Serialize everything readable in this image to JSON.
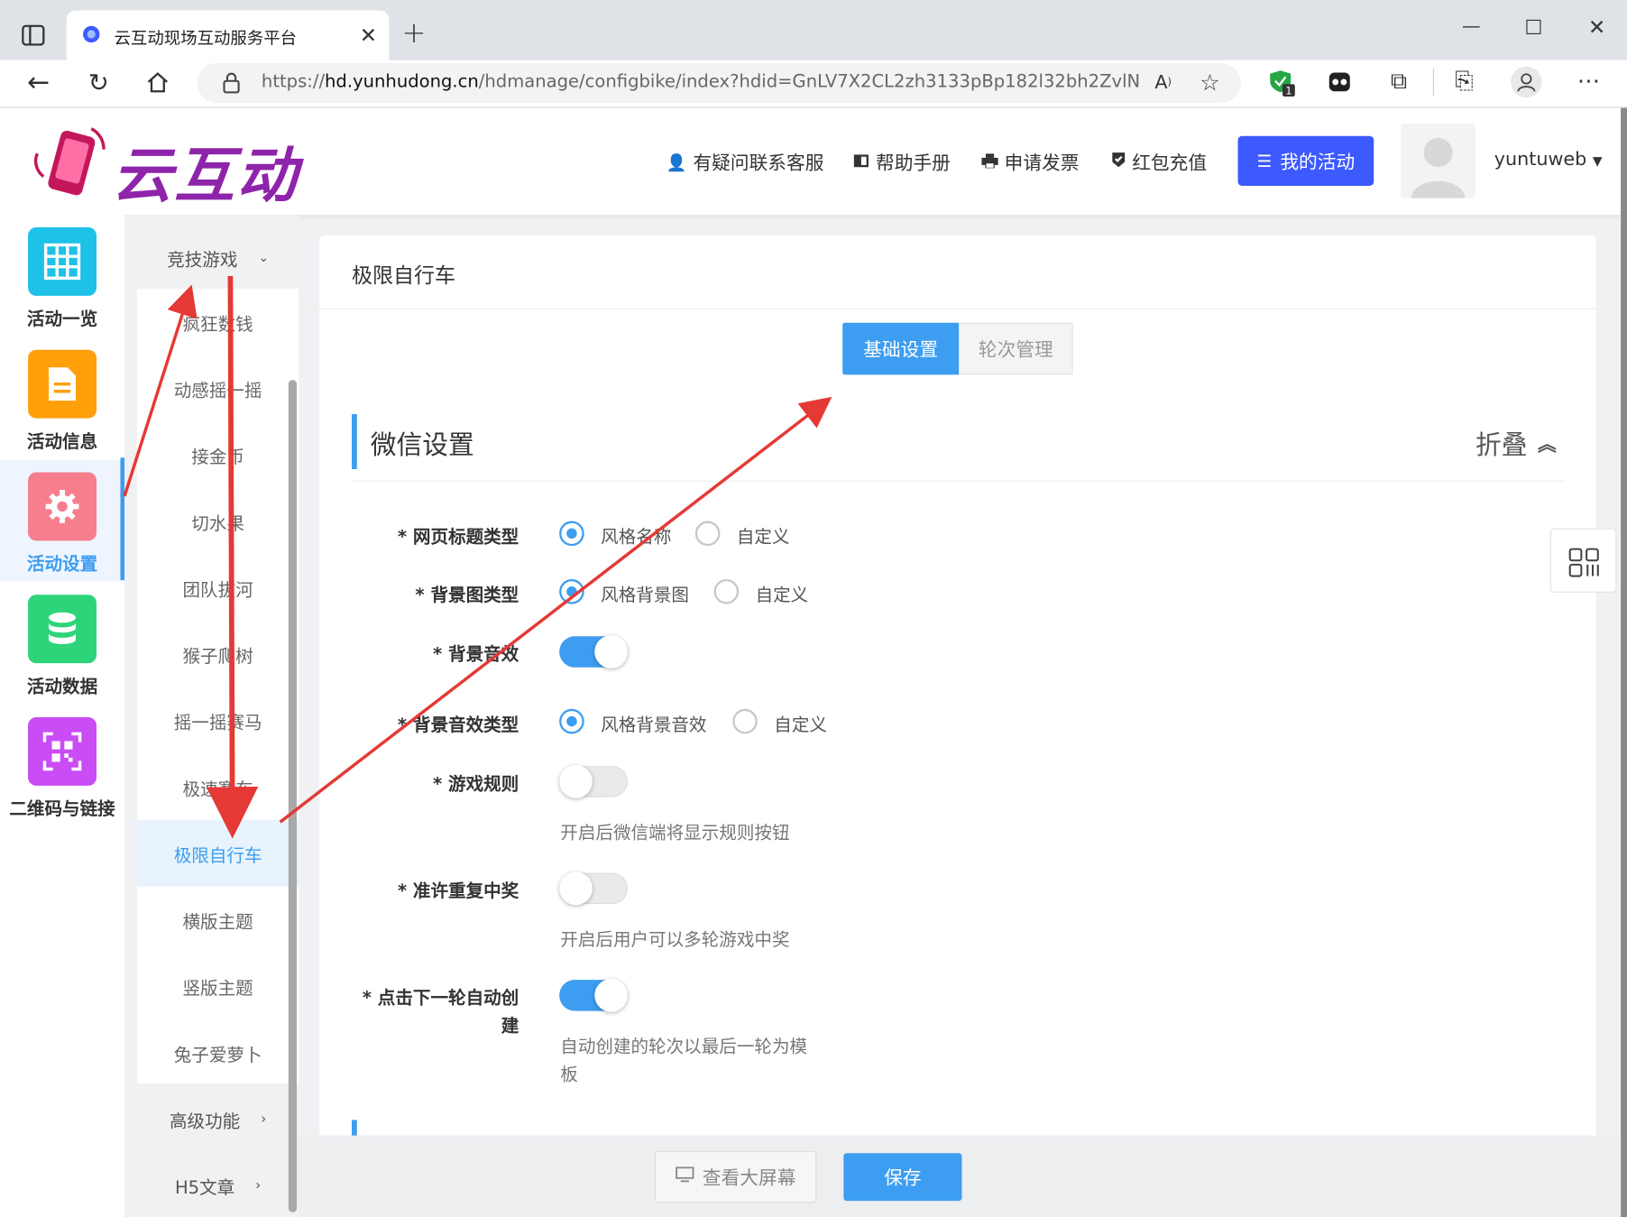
{
  "browser": {
    "tab_title": "云互动现场互动服务平台",
    "url_prefix": "https://",
    "url_host": "hd.yunhudong.cn",
    "url_path": "/hdmanage/configbike/index?hdid=GnLV7X2CL2zh3133pBp182l32bh2ZvlN",
    "ext_badge": "1"
  },
  "header": {
    "logo_text": "云互动",
    "links": [
      "有疑问联系客服",
      "帮助手册",
      "申请发票",
      "红包充值"
    ],
    "my_activity": "我的活动",
    "username": "yuntuweb"
  },
  "icon_sidebar": [
    {
      "label": "活动一览",
      "color": "#1ec1e8",
      "active": false
    },
    {
      "label": "活动信息",
      "color": "#ff9f0a",
      "active": false
    },
    {
      "label": "活动设置",
      "color": "#f77e8d",
      "active": true
    },
    {
      "label": "活动数据",
      "color": "#2ed47a",
      "active": false
    },
    {
      "label": "二维码与链接",
      "color": "#c94cf5",
      "active": false
    }
  ],
  "sub_sidebar": {
    "group_title": "竞技游戏",
    "items": [
      "疯狂数钱",
      "动感摇一摇",
      "接金币",
      "切水果",
      "团队拔河",
      "猴子爬树",
      "摇一摇赛马",
      "极速赛车",
      "极限自行车",
      "横版主题",
      "竖版主题",
      "兔子爱萝卜"
    ],
    "active_index": 8,
    "advanced": "高级功能",
    "h5": "H5文章"
  },
  "page": {
    "title": "极限自行车",
    "tabs": [
      "基础设置",
      "轮次管理"
    ],
    "section_title": "微信设置",
    "collapse": "折叠",
    "fields": {
      "page_title_type": {
        "label": "* 网页标题类型",
        "options": [
          "风格名称",
          "自定义"
        ],
        "selected": 0
      },
      "bg_image_type": {
        "label": "* 背景图类型",
        "options": [
          "风格背景图",
          "自定义"
        ],
        "selected": 0
      },
      "bg_music": {
        "label": "* 背景音效",
        "on": true
      },
      "bg_music_type": {
        "label": "* 背景音效类型",
        "options": [
          "风格背景音效",
          "自定义"
        ],
        "selected": 0
      },
      "game_rules": {
        "label": "* 游戏规则",
        "on": false,
        "hint": "开启后微信端将显示规则按钮"
      },
      "repeat_win": {
        "label": "* 准许重复中奖",
        "on": false,
        "hint": "开启后用户可以多轮游戏中奖"
      },
      "auto_next": {
        "label_line1": "* 点击下一轮自动创",
        "label_line2": "建",
        "on": true,
        "hint_line1": "自动创建的轮次以最后一轮为模",
        "hint_line2": "板"
      }
    }
  },
  "footer": {
    "view_screen": "查看大屏幕",
    "save": "保存"
  },
  "colors": {
    "accent": "#3d9df0",
    "primary": "#3d5afe",
    "annotation": "#e53935"
  }
}
